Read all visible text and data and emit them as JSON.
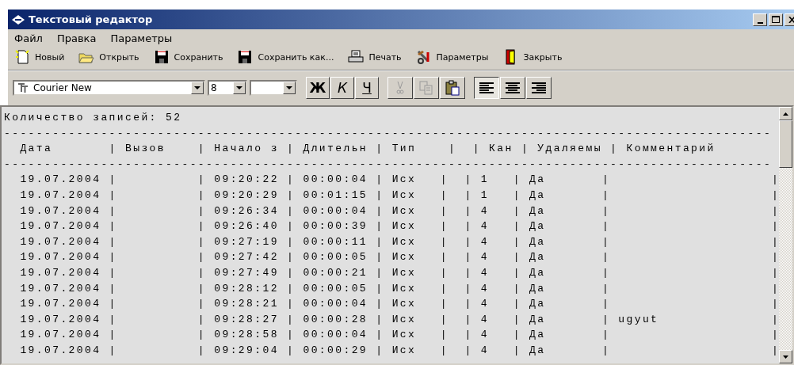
{
  "window": {
    "title": "Текстовый редактор"
  },
  "menu": [
    "Файл",
    "Правка",
    "Параметры"
  ],
  "toolbar": [
    {
      "label": "Новый"
    },
    {
      "label": "Открыть"
    },
    {
      "label": "Сохранить"
    },
    {
      "label": "Сохранить как..."
    },
    {
      "label": "Печать"
    },
    {
      "label": "Параметры"
    },
    {
      "label": "Закрыть"
    }
  ],
  "format_bar": {
    "font": "Courier New",
    "size": "8",
    "style_buttons": [
      {
        "label": "Ж",
        "kind": "bold"
      },
      {
        "label": "К",
        "kind": "italic"
      },
      {
        "label": "Ч",
        "kind": "underline"
      }
    ],
    "edit_buttons": [
      {
        "disabled": true
      },
      {
        "disabled": true
      },
      {
        "disabled": false
      }
    ],
    "align_buttons": [
      {
        "selected": true
      },
      {
        "selected": false
      },
      {
        "selected": false
      }
    ]
  },
  "document": {
    "lines": [
      "Количество записей: 52",
      "-----------------------------------------------------------------------------------------------",
      "  Дата       | Вызов    | Начало з | Длительн | Тип    |  | Кан | Удаляемы | Комментарий",
      "-----------------------------------------------------------------------------------------------",
      "  19.07.2004 |          | 09:20:22 | 00:00:04 | Исх   |  | 1   | Да       |                    |",
      "  19.07.2004 |          | 09:20:29 | 00:01:15 | Исх   |  | 1   | Да       |                    |",
      "  19.07.2004 |          | 09:26:34 | 00:00:04 | Исх   |  | 4   | Да       |                    |",
      "  19.07.2004 |          | 09:26:40 | 00:00:39 | Исх   |  | 4   | Да       |                    |",
      "  19.07.2004 |          | 09:27:19 | 00:00:11 | Исх   |  | 4   | Да       |                    |",
      "  19.07.2004 |          | 09:27:42 | 00:00:05 | Исх   |  | 4   | Да       |                    |",
      "  19.07.2004 |          | 09:27:49 | 00:00:21 | Исх   |  | 4   | Да       |                    |",
      "  19.07.2004 |          | 09:28:12 | 00:00:05 | Исх   |  | 4   | Да       |                    |",
      "  19.07.2004 |          | 09:28:21 | 00:00:04 | Исх   |  | 4   | Да       |                    |",
      "  19.07.2004 |          | 09:28:27 | 00:00:28 | Исх   |  | 4   | Да       | ugyut              |",
      "  19.07.2004 |          | 09:28:58 | 00:00:04 | Исх   |  | 4   | Да       |                    |",
      "  19.07.2004 |          | 09:29:04 | 00:00:29 | Исх   |  | 4   | Да       |                    |"
    ]
  }
}
